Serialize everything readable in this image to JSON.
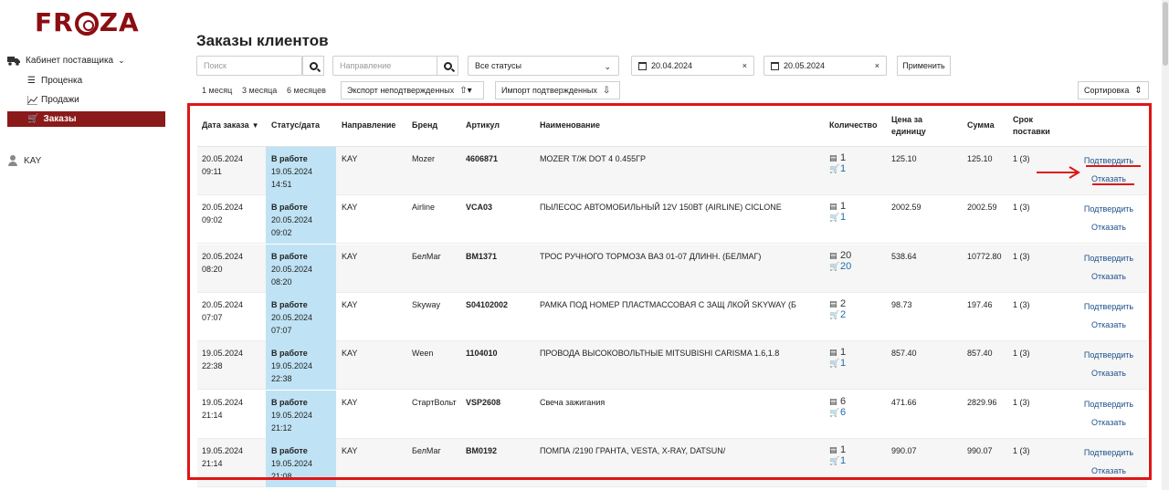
{
  "brand": {
    "logo_text_pre": "FR",
    "logo_text_post": "ZA"
  },
  "sidebar": {
    "section_label": "Кабинет поставщика",
    "items": [
      {
        "label": "Проценка",
        "icon": "list-icon"
      },
      {
        "label": "Продажи",
        "icon": "chart-icon"
      },
      {
        "label": "Заказы",
        "icon": "cart-icon",
        "active": true
      }
    ],
    "user": "KAY"
  },
  "page": {
    "title": "Заказы клиентов"
  },
  "filters": {
    "search_placeholder": "Поиск",
    "direction_placeholder": "Направление",
    "status_value": "Все статусы",
    "date_from": "20.04.2024",
    "date_to": "20.05.2024",
    "apply_label": "Применить"
  },
  "periods": [
    "1 месяц",
    "3 месяца",
    "6 месяцев"
  ],
  "actions": {
    "export_label": "Экспорт неподтвержденных",
    "import_label": "Импорт подтвержденных",
    "sort_label": "Сортировка"
  },
  "table": {
    "headers": {
      "date": "Дата заказа",
      "status": "Статус/дата",
      "direction": "Направление",
      "brand": "Бренд",
      "article": "Артикул",
      "name": "Наименование",
      "qty": "Количество",
      "price": "Цена за единицу",
      "sum": "Сумма",
      "term": "Срок поставки"
    },
    "confirm_label": "Подтвердить",
    "reject_label": "Отказать",
    "rows": [
      {
        "date": "20.05.2024",
        "time": "09:11",
        "status": "В работе",
        "status_date": "19.05.2024",
        "status_time": "14:51",
        "direction": "KAY",
        "brand": "Mozer",
        "article": "4606871",
        "name": "MOZER Т/Ж DOT 4 0.455ГР",
        "qty_stock": "1",
        "qty_cart": "1",
        "price": "125.10",
        "sum": "125.10",
        "term": "1 (3)"
      },
      {
        "date": "20.05.2024",
        "time": "09:02",
        "status": "В работе",
        "status_date": "20.05.2024",
        "status_time": "09:02",
        "direction": "KAY",
        "brand": "Airline",
        "article": "VCA03",
        "name": "ПЫЛЕСОС АВТОМОБИЛЬНЫЙ 12V 150ВТ (AIRLINE) CICLONE",
        "qty_stock": "1",
        "qty_cart": "1",
        "price": "2002.59",
        "sum": "2002.59",
        "term": "1 (3)"
      },
      {
        "date": "20.05.2024",
        "time": "08:20",
        "status": "В работе",
        "status_date": "20.05.2024",
        "status_time": "08:20",
        "direction": "KAY",
        "brand": "БелМаг",
        "article": "BM1371",
        "name": "ТРОС РУЧНОГО ТОРМОЗА ВАЗ 01-07 ДЛИНН. (БЕЛМАГ)",
        "qty_stock": "20",
        "qty_cart": "20",
        "price": "538.64",
        "sum": "10772.80",
        "term": "1 (3)"
      },
      {
        "date": "20.05.2024",
        "time": "07:07",
        "status": "В работе",
        "status_date": "20.05.2024",
        "status_time": "07:07",
        "direction": "KAY",
        "brand": "Skyway",
        "article": "S04102002",
        "name": "РАМКА ПОД НОМЕР ПЛАСТМАССОВАЯ С ЗАЩ ЛКОЙ SKYWAY (Б",
        "qty_stock": "2",
        "qty_cart": "2",
        "price": "98.73",
        "sum": "197.46",
        "term": "1 (3)"
      },
      {
        "date": "19.05.2024",
        "time": "22:38",
        "status": "В работе",
        "status_date": "19.05.2024",
        "status_time": "22:38",
        "direction": "KAY",
        "brand": "Ween",
        "article": "1104010",
        "name": "ПРОВОДА ВЫСОКОВОЛЬТНЫЕ MITSUBISHI CARISMA 1.6,1.8",
        "qty_stock": "1",
        "qty_cart": "1",
        "price": "857.40",
        "sum": "857.40",
        "term": "1 (3)"
      },
      {
        "date": "19.05.2024",
        "time": "21:14",
        "status": "В работе",
        "status_date": "19.05.2024",
        "status_time": "21:12",
        "direction": "KAY",
        "brand": "СтартВольт",
        "article": "VSP2608",
        "name": "Свеча зажигания",
        "qty_stock": "6",
        "qty_cart": "6",
        "price": "471.66",
        "sum": "2829.96",
        "term": "1 (3)"
      },
      {
        "date": "19.05.2024",
        "time": "21:14",
        "status": "В работе",
        "status_date": "19.05.2024",
        "status_time": "21:08",
        "direction": "KAY",
        "brand": "БелМаг",
        "article": "BM0192",
        "name": "ПОМПА /2190 ГРАНТА, VESTA, X-RAY, DATSUN/",
        "qty_stock": "1",
        "qty_cart": "1",
        "price": "990.07",
        "sum": "990.07",
        "term": "1 (3)"
      }
    ]
  },
  "colors": {
    "brand": "#8b0e12",
    "active_nav": "#8b1a1a",
    "status_bg": "#bfe3f4",
    "link": "#1b4f8a",
    "annotation": "#e01515"
  }
}
